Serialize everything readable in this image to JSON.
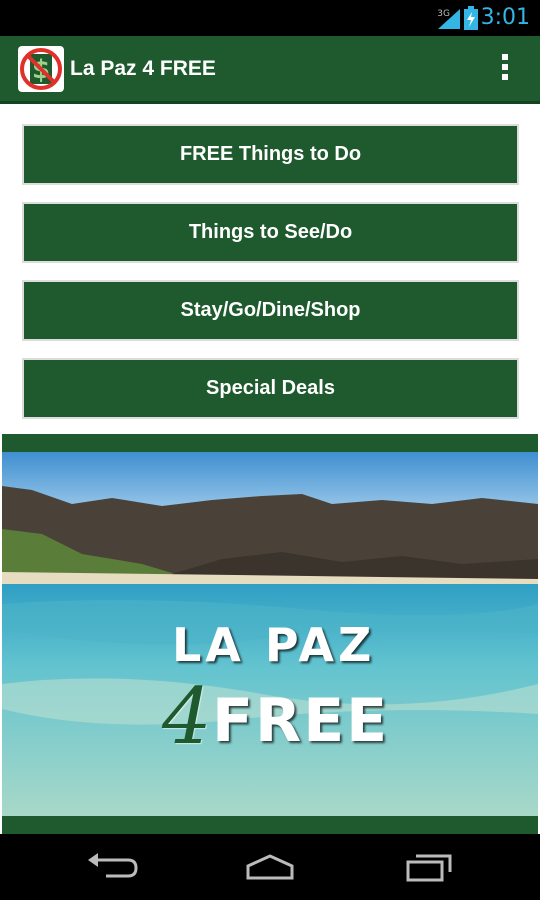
{
  "status_bar": {
    "network": "3G",
    "time": "3:01",
    "icons": [
      "signal-icon",
      "battery-charging-icon"
    ]
  },
  "action_bar": {
    "title": "La Paz 4 FREE",
    "app_icon": "no-dollar-logo-icon",
    "overflow_icon": "overflow-menu-icon"
  },
  "menu": {
    "buttons": [
      {
        "label": "FREE Things to Do"
      },
      {
        "label": "Things to See/Do"
      },
      {
        "label": "Stay/Go/Dine/Shop"
      },
      {
        "label": "Special Deals"
      }
    ]
  },
  "banner": {
    "title": "LA PAZ",
    "number": "4",
    "free": "FREE"
  },
  "nav_bar": {
    "icons": [
      "back-icon",
      "home-icon",
      "recent-apps-icon"
    ]
  },
  "colors": {
    "brand_green": "#1f5a2e",
    "status_accent": "#33b5e5"
  }
}
